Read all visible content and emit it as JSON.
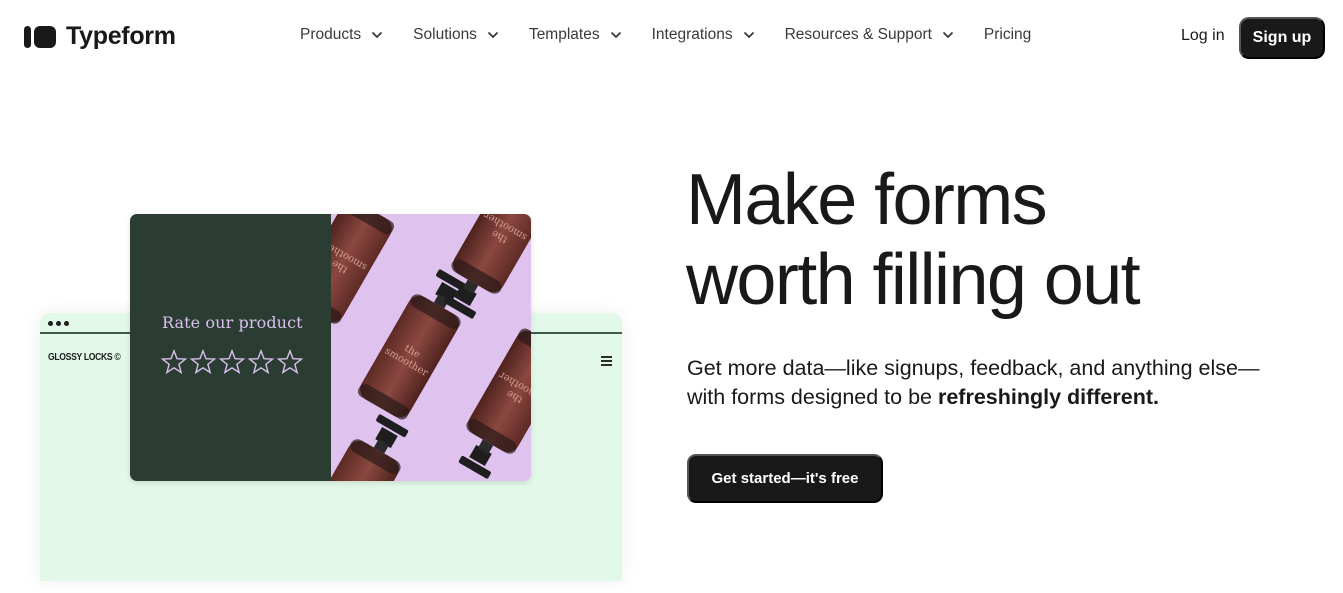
{
  "header": {
    "logo_text": "Typeform",
    "nav": [
      {
        "label": "Products",
        "has_dropdown": true
      },
      {
        "label": "Solutions",
        "has_dropdown": true
      },
      {
        "label": "Templates",
        "has_dropdown": true
      },
      {
        "label": "Integrations",
        "has_dropdown": true
      },
      {
        "label": "Resources & Support",
        "has_dropdown": true
      },
      {
        "label": "Pricing",
        "has_dropdown": false
      }
    ],
    "login_label": "Log in",
    "signup_label": "Sign up"
  },
  "hero": {
    "headline_line1": "Make forms",
    "headline_line2": "worth filling out",
    "subtext_plain": "Get more data—like signups, feedback, and anything else—with forms designed to be ",
    "subtext_bold": "refreshingly different.",
    "cta_label": "Get started—it's free"
  },
  "illustration": {
    "brand_name": "GLOSSY LOCKS ©",
    "card_title": "Rate our product",
    "star_count": 5,
    "rating": 0,
    "product_label": "the smoother",
    "colors": {
      "card_dark": "#2b3d33",
      "card_lilac": "#e0c2ef",
      "browser_mint": "#e2f8e8",
      "bottle": "#7a3a33",
      "title_text": "#d9c1ec"
    }
  },
  "colors": {
    "primary": "#191919",
    "background": "#ffffff"
  }
}
